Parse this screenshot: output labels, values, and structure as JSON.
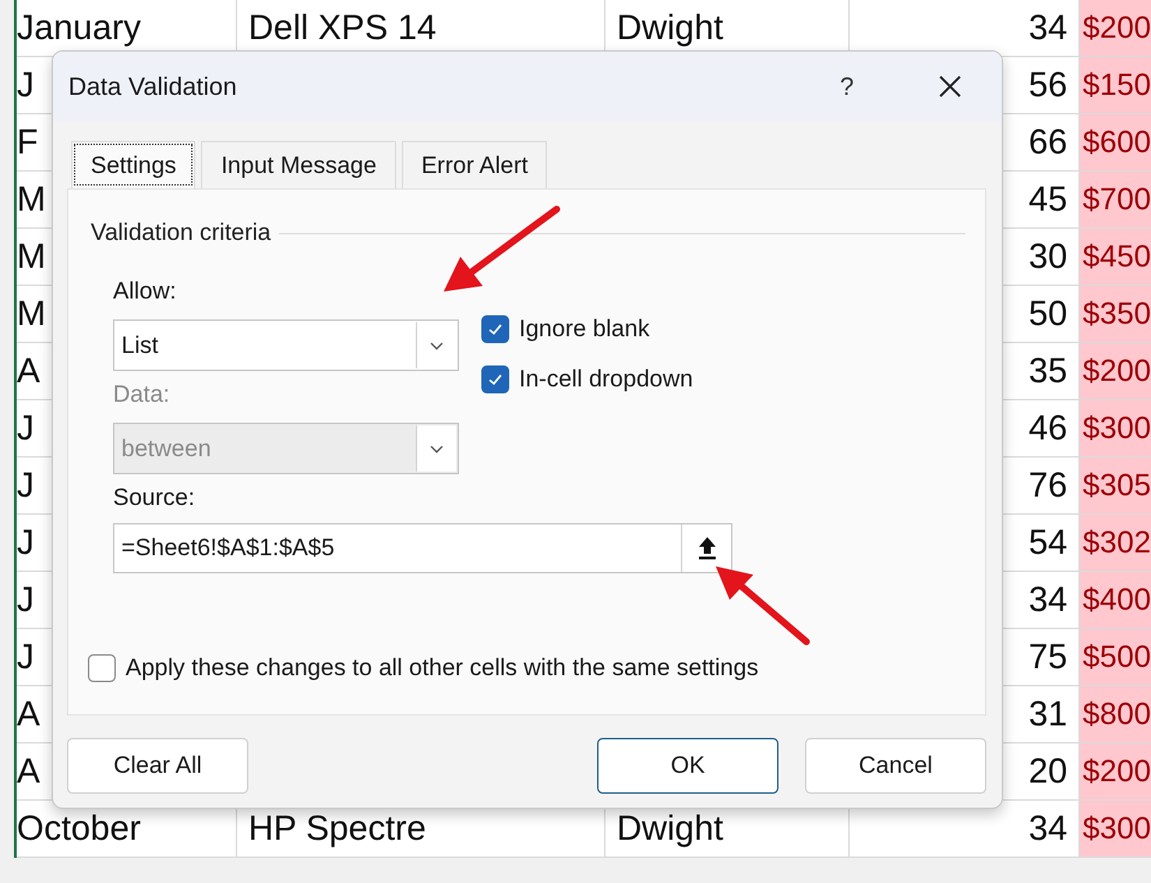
{
  "sheet": {
    "rows": [
      {
        "month": "January",
        "product": "Dell XPS 14",
        "person": "Dwight",
        "qty": "34",
        "amount": "$200"
      },
      {
        "month": "J",
        "qty": "56",
        "amount": "$150"
      },
      {
        "month": "F",
        "qty": "66",
        "amount": "$600"
      },
      {
        "month": "M",
        "qty": "45",
        "amount": "$700"
      },
      {
        "month": "M",
        "qty": "30",
        "amount": "$450"
      },
      {
        "month": "M",
        "qty": "50",
        "amount": "$350"
      },
      {
        "month": "A",
        "qty": "35",
        "amount": "$200"
      },
      {
        "month": "J",
        "qty": "46",
        "amount": "$300"
      },
      {
        "month": "J",
        "qty": "76",
        "amount": "$305"
      },
      {
        "month": "J",
        "qty": "54",
        "amount": "$302"
      },
      {
        "month": "J",
        "qty": "34",
        "amount": "$400"
      },
      {
        "month": "J",
        "qty": "75",
        "amount": "$500"
      },
      {
        "month": "A",
        "qty": "31",
        "amount": "$800"
      },
      {
        "month": "A",
        "qty": "20",
        "amount": "$200"
      },
      {
        "month": "October",
        "product": "HP Spectre",
        "person": "Dwight",
        "qty": "34",
        "amount": "$300"
      }
    ]
  },
  "dialog": {
    "title": "Data Validation",
    "help": "?",
    "tabs": [
      {
        "label": "Settings",
        "selected": true
      },
      {
        "label": "Input Message",
        "selected": false
      },
      {
        "label": "Error Alert",
        "selected": false
      }
    ],
    "group_label": "Validation criteria",
    "allow": {
      "label": "Allow:",
      "value": "List",
      "disabled": false
    },
    "data": {
      "label": "Data:",
      "value": "between",
      "disabled": true
    },
    "checkboxes": [
      {
        "label": "Ignore blank",
        "checked": true
      },
      {
        "label": "In-cell dropdown",
        "checked": true
      }
    ],
    "source": {
      "label": "Source:",
      "value": "=Sheet6!$A$1:$A$5"
    },
    "apply": {
      "label": "Apply these changes to all other cells with the same settings",
      "checked": false
    },
    "buttons": [
      {
        "label": "Clear All",
        "default": false,
        "kind": "left"
      },
      {
        "label": "OK",
        "default": true,
        "kind": "right"
      },
      {
        "label": "Cancel",
        "default": false,
        "kind": "right"
      }
    ]
  }
}
